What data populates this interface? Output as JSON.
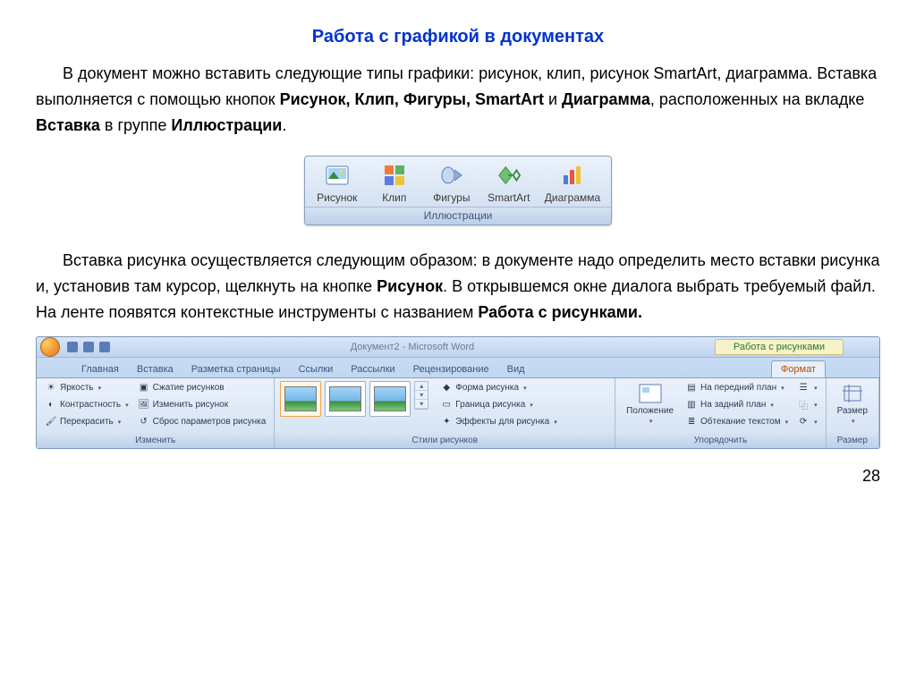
{
  "heading": "Работа с графикой в документах",
  "para1_a": "В документ можно вставить следующие типы графики",
  "para1_b": ": рисунок, клип, рисунок SmartArt, диаграмма. Вставка выполняется с помощью кнопок ",
  "para1_bold1": "Рисунок, Клип, Фигуры, SmartArt",
  "para1_c": " и ",
  "para1_bold2": "Диаграмма",
  "para1_d": ", расположенных на вкладке ",
  "para1_bold3": "Вставка",
  "para1_e": " в группе ",
  "para1_bold4": "Иллюстрации",
  "para1_f": ".",
  "illus": {
    "items": [
      "Рисунок",
      "Клип",
      "Фигуры",
      "SmartArt",
      "Диаграмма"
    ],
    "title": "Иллюстрации"
  },
  "para2_a": "Вставка рисунка осуществляется следующим образом: в документе надо определить место вставки рисунка и, установив там курсор, щелкнуть на кнопке ",
  "para2_bold1": "Рисунок",
  "para2_b": ". В открывшемся окне диалога выбрать требуемый файл. На ленте появятся контекстные инструменты с названием ",
  "para2_bold2": "Работа с рисунками.",
  "ribbon": {
    "doc_title": "Документ2 - Microsoft Word",
    "context_title": "Работа с рисунками",
    "tabs": [
      "Главная",
      "Вставка",
      "Разметка страницы",
      "Ссылки",
      "Рассылки",
      "Рецензирование",
      "Вид"
    ],
    "context_tab": "Формат",
    "group_adjust": {
      "title": "Изменить",
      "brightness": "Яркость",
      "contrast": "Контрастность",
      "recolor": "Перекрасить",
      "compress": "Сжатие рисунков",
      "change": "Изменить рисунок",
      "reset": "Сброс параметров рисунка"
    },
    "group_styles": {
      "title": "Стили рисунков",
      "shape": "Форма рисунка",
      "border": "Граница рисунка",
      "effects": "Эффекты для рисунка"
    },
    "group_arrange": {
      "title": "Упорядочить",
      "position": "Положение",
      "front": "На передний план",
      "back": "На задний план",
      "wrap": "Обтекание текстом"
    },
    "group_size": {
      "title": "Размер"
    }
  },
  "page_number": "28"
}
